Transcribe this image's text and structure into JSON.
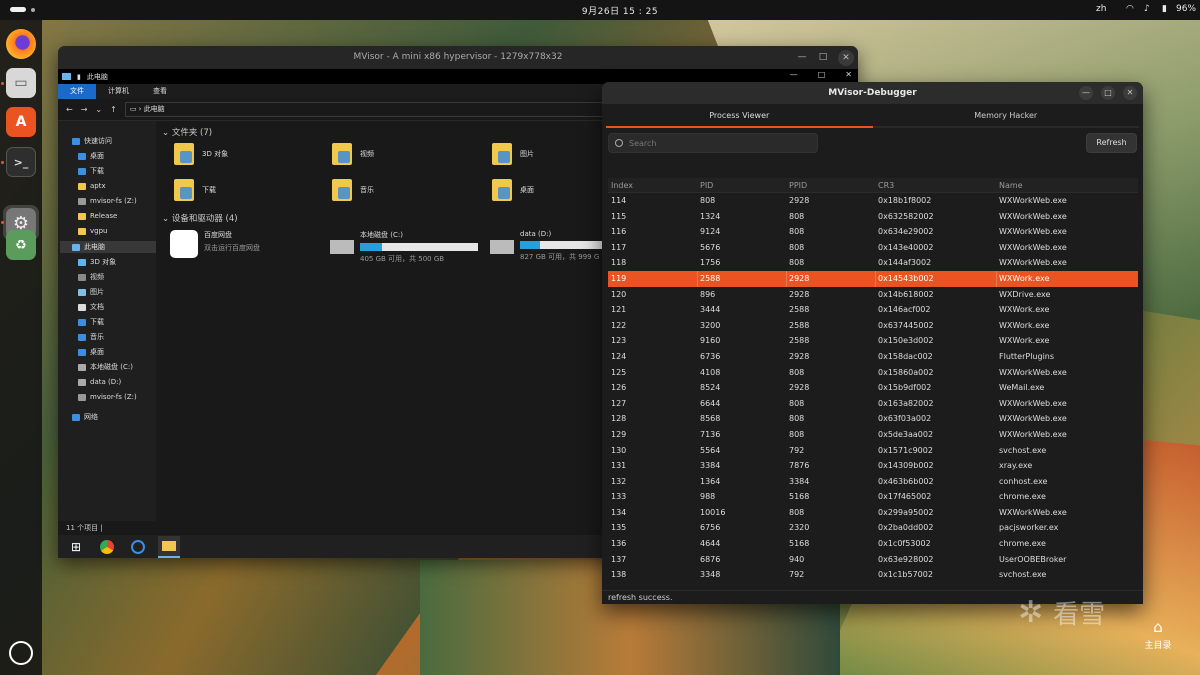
{
  "topbar": {
    "clock": "9月26日  15 : 25",
    "language": "zh",
    "battery": "96%"
  },
  "dock": {
    "apps": [
      "firefox-icon",
      "files-icon",
      "software-icon",
      "terminal-icon",
      "settings-icon",
      "trash-icon"
    ],
    "logo": "ubuntu-icon"
  },
  "vm_window": {
    "title": "MVisor - A mini x86 hypervisor - 1279x778x32",
    "explorer": {
      "window_title": "此电脑",
      "ribbon_tabs": [
        "文件",
        "计算机",
        "查看"
      ],
      "address": "此电脑",
      "nav_items": [
        "快速访问",
        "桌面",
        "下载",
        "aptx",
        "mvisor-fs (Z:)",
        "Release",
        "vgpu",
        "此电脑",
        "3D 对象",
        "视频",
        "图片",
        "文档",
        "下载",
        "音乐",
        "桌面",
        "本地磁盘 (C:)",
        "data (D:)",
        "mvisor-fs (Z:)",
        "网络"
      ],
      "folders_header": "文件夹 (7)",
      "folders": [
        "3D 对象",
        "视频",
        "图片",
        "下载",
        "音乐",
        "桌面"
      ],
      "devices_header": "设备和驱动器 (4)",
      "devices": [
        {
          "name": "百度网盘",
          "sub": "双击运行百度网盘",
          "fill": null
        },
        {
          "name": "本地磁盘 (C:)",
          "sub": "405 GB 可用，共 500 GB",
          "fill": 0.19
        },
        {
          "name": "data (D:)",
          "sub": "827 GB 可用，共 999 G",
          "fill": 0.17
        }
      ],
      "status": "11 个项目  |"
    }
  },
  "debugger": {
    "title": "MVisor-Debugger",
    "tabs": [
      "Process Viewer",
      "Memory Hacker"
    ],
    "search_placeholder": "Search",
    "refresh_label": "Refresh",
    "columns": [
      "Index",
      "PID",
      "PPID",
      "CR3",
      "Name"
    ],
    "rows": [
      [
        "114",
        "808",
        "2928",
        "0x18b1f8002",
        "WXWorkWeb.exe"
      ],
      [
        "115",
        "1324",
        "808",
        "0x632582002",
        "WXWorkWeb.exe"
      ],
      [
        "116",
        "9124",
        "808",
        "0x634e29002",
        "WXWorkWeb.exe"
      ],
      [
        "117",
        "5676",
        "808",
        "0x143e40002",
        "WXWorkWeb.exe"
      ],
      [
        "118",
        "1756",
        "808",
        "0x144af3002",
        "WXWorkWeb.exe"
      ],
      [
        "119",
        "2588",
        "2928",
        "0x14543b002",
        "WXWork.exe"
      ],
      [
        "120",
        "896",
        "2928",
        "0x14b618002",
        "WXDrive.exe"
      ],
      [
        "121",
        "3444",
        "2588",
        "0x146acf002",
        "WXWork.exe"
      ],
      [
        "122",
        "3200",
        "2588",
        "0x637445002",
        "WXWork.exe"
      ],
      [
        "123",
        "9160",
        "2588",
        "0x150e3d002",
        "WXWork.exe"
      ],
      [
        "124",
        "6736",
        "2928",
        "0x158dac002",
        "FlutterPlugins"
      ],
      [
        "125",
        "4108",
        "808",
        "0x15860a002",
        "WXWorkWeb.exe"
      ],
      [
        "126",
        "8524",
        "2928",
        "0x15b9df002",
        "WeMail.exe"
      ],
      [
        "127",
        "6644",
        "808",
        "0x163a82002",
        "WXWorkWeb.exe"
      ],
      [
        "128",
        "8568",
        "808",
        "0x63f03a002",
        "WXWorkWeb.exe"
      ],
      [
        "129",
        "7136",
        "808",
        "0x5de3aa002",
        "WXWorkWeb.exe"
      ],
      [
        "130",
        "5564",
        "792",
        "0x1571c9002",
        "svchost.exe"
      ],
      [
        "131",
        "3384",
        "7876",
        "0x14309b002",
        "xray.exe"
      ],
      [
        "132",
        "1364",
        "3384",
        "0x463b6b002",
        "conhost.exe"
      ],
      [
        "133",
        "988",
        "5168",
        "0x17f465002",
        "chrome.exe"
      ],
      [
        "134",
        "10016",
        "808",
        "0x299a95002",
        "WXWorkWeb.exe"
      ],
      [
        "135",
        "6756",
        "2320",
        "0x2ba0dd002",
        "pacjsworker.ex"
      ],
      [
        "136",
        "4644",
        "5168",
        "0x1c0f53002",
        "chrome.exe"
      ],
      [
        "137",
        "6876",
        "940",
        "0x63e928002",
        "UserOOBEBroker"
      ],
      [
        "138",
        "3348",
        "792",
        "0x1c1b57002",
        "svchost.exe"
      ]
    ],
    "selected_row_index": 5,
    "status": "refresh success."
  },
  "watermark": "看雪",
  "desktop_home_label": "主目录",
  "colors": {
    "accent": "#e95420",
    "selection_blue": "#1b6ac9",
    "drive_fill": "#26a0da"
  }
}
